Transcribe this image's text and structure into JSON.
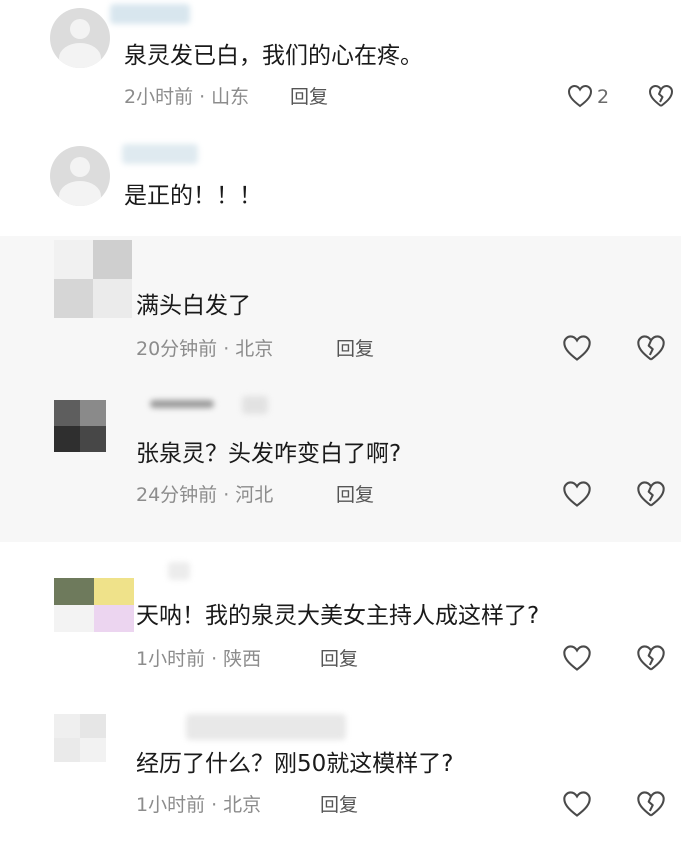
{
  "colors": {
    "background": "#ffffff",
    "alt_background": "#f7f7f7",
    "text": "#1a1a1a",
    "meta": "#8c8c8c",
    "icon": "#4a4a4a"
  },
  "comments": [
    {
      "text": "泉灵发已白，我们的心在疼。",
      "time": "2小时前",
      "location": "山东",
      "reply_label": "回复",
      "like_count": "2",
      "avatar": "default-avatar-icon"
    },
    {
      "text": "是正的！！！",
      "avatar": "default-avatar-icon"
    },
    {
      "text": "满头白发了",
      "time": "20分钟前",
      "location": "北京",
      "reply_label": "回复",
      "avatar": "mosaic-avatar"
    },
    {
      "text": "张泉灵？头发咋变白了啊?",
      "time": "24分钟前",
      "location": "河北",
      "reply_label": "回复",
      "avatar": "mosaic-avatar"
    },
    {
      "text": "天呐！我的泉灵大美女主持人成这样了?",
      "time": "1小时前",
      "location": "陕西",
      "reply_label": "回复",
      "avatar": "mosaic-avatar"
    },
    {
      "text": "经历了什么？刚50就这模样了?",
      "time": "1小时前",
      "location": "北京",
      "reply_label": "回复",
      "avatar": "mosaic-avatar"
    }
  ],
  "meta_separator": "·"
}
